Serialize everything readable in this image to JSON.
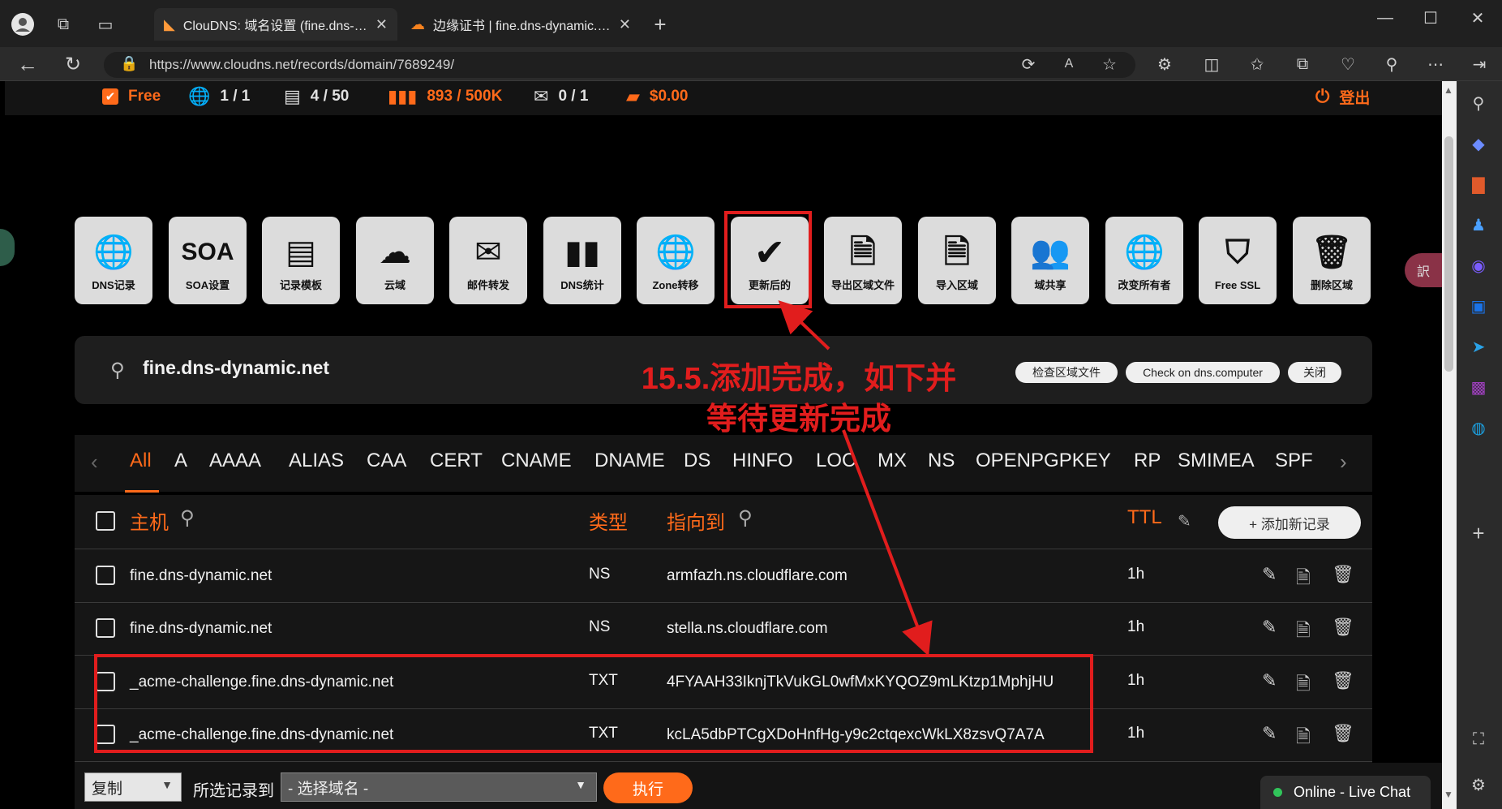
{
  "browser": {
    "tabs": [
      {
        "title": "ClouDNS: 域名设置 (fine.dns-dyn",
        "active": true
      },
      {
        "title": "边缘证书 | fine.dns-dynamic.net |",
        "active": false
      }
    ],
    "url": "https://www.cloudns.net/records/domain/7689249/"
  },
  "status": {
    "plan": "Free",
    "zones": "1 / 1",
    "records": "4 / 50",
    "queries": "893 / 500K",
    "mail": "0 / 1",
    "balance": "$0.00",
    "logout": "登出"
  },
  "tools": [
    {
      "label": "DNS记录",
      "icon": "globe-icon",
      "glyph": "🌐"
    },
    {
      "label": "SOA设置",
      "icon": "soa-text-icon",
      "glyph": "SOA"
    },
    {
      "label": "记录模板",
      "icon": "template-icon",
      "glyph": "▤"
    },
    {
      "label": "云域",
      "icon": "cloud-icon",
      "glyph": "☁"
    },
    {
      "label": "邮件转发",
      "icon": "mail-forward-icon",
      "glyph": "✉"
    },
    {
      "label": "DNS统计",
      "icon": "bar-chart-icon",
      "glyph": "▮▮"
    },
    {
      "label": "Zone转移",
      "icon": "globe-transfer-icon",
      "glyph": "🌐"
    },
    {
      "label": "更新后的",
      "icon": "checkmark-icon",
      "glyph": "✔"
    },
    {
      "label": "导出区域文件",
      "icon": "export-file-icon",
      "glyph": "🗎"
    },
    {
      "label": "导入区域",
      "icon": "import-file-icon",
      "glyph": "🗎"
    },
    {
      "label": "域共享",
      "icon": "users-icon",
      "glyph": "👥"
    },
    {
      "label": "改变所有者",
      "icon": "globe-owner-icon",
      "glyph": "🌐"
    },
    {
      "label": "Free SSL",
      "icon": "ssl-shield-icon",
      "glyph": "⛉"
    },
    {
      "label": "删除区域",
      "icon": "trash-icon",
      "glyph": "🗑"
    }
  ],
  "search": {
    "domain": "fine.dns-dynamic.net",
    "buttons": [
      "检查区域文件",
      "Check on dns.computer",
      "关闭"
    ]
  },
  "types": [
    "All",
    "A",
    "AAAA",
    "ALIAS",
    "CAA",
    "CERT",
    "CNAME",
    "DNAME",
    "DS",
    "HINFO",
    "LOC",
    "MX",
    "NS",
    "OPENPGPKEY",
    "RP",
    "SMIMEA",
    "SPF"
  ],
  "table": {
    "headers": {
      "host": "主机",
      "type": "类型",
      "points_to": "指向到",
      "ttl": "TTL",
      "add": "+ 添加新记录"
    },
    "rows": [
      {
        "host": "fine.dns-dynamic.net",
        "type": "NS",
        "value": "armfazh.ns.cloudflare.com",
        "ttl": "1h"
      },
      {
        "host": "fine.dns-dynamic.net",
        "type": "NS",
        "value": "stella.ns.cloudflare.com",
        "ttl": "1h"
      },
      {
        "host": "_acme-challenge.fine.dns-dynamic.net",
        "type": "TXT",
        "value": "4FYAAH33IknjTkVukGL0wfMxKYQOZ9mLKtzp1MphjHU",
        "ttl": "1h"
      },
      {
        "host": "_acme-challenge.fine.dns-dynamic.net",
        "type": "TXT",
        "value": "kcLA5dbPTCgXDoHnfHg-y9c2ctqexcWkLX8zsvQ7A7A",
        "ttl": "1h"
      }
    ]
  },
  "bottom": {
    "action_select": "复制",
    "label": "所选记录到",
    "domain_select": "- 选择域名 -",
    "execute": "执行",
    "chat": "Online - Live Chat"
  },
  "annotation": {
    "line1": "15.5.添加完成，如下并",
    "line2": "等待更新完成"
  },
  "colors": {
    "accent": "#ff6a1a",
    "annotation": "#e11d1d"
  }
}
